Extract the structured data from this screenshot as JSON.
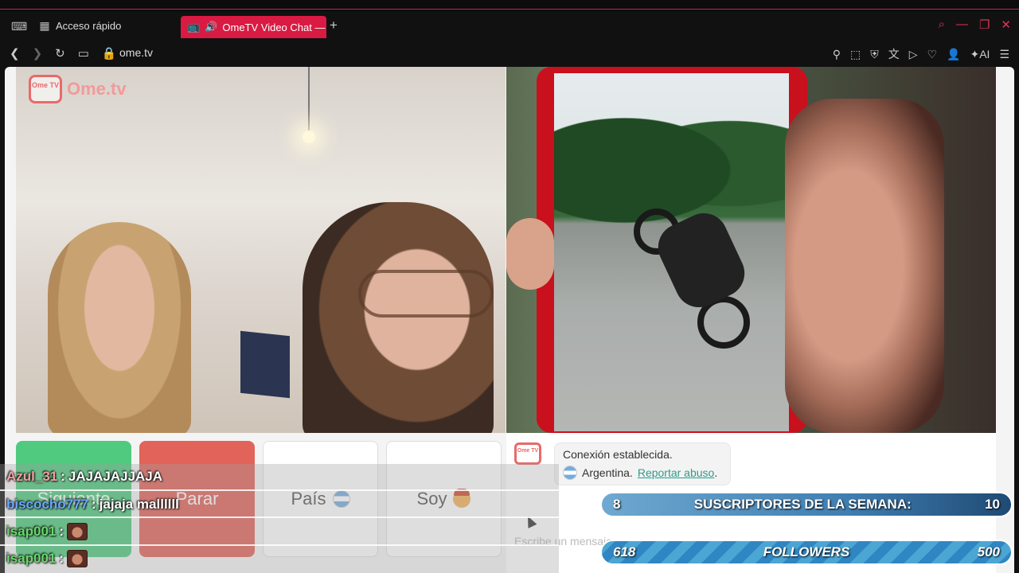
{
  "browser": {
    "quick_access_label": "Acceso rápido",
    "active_tab_title": "OmeTV Video Chat —",
    "new_tab_symbol": "+",
    "url": "ome.tv",
    "ai_label": "AI"
  },
  "site": {
    "logo_text": "Ome.tv",
    "logo_badge": "Ome TV"
  },
  "controls": {
    "next_label": "Siguiente",
    "stop_label": "Parar",
    "country_label": "País",
    "me_label": "Soy"
  },
  "chat": {
    "status": "Conexión establecida.",
    "country": "Argentina.",
    "report_link": "Reportar abuso",
    "report_suffix": ".",
    "input_placeholder": "Escribe un mensaje"
  },
  "stream_chat": [
    {
      "user": "Azul_31",
      "sep": " : ",
      "message": "JAJAJAJJAJA",
      "color": "#f0a0a0"
    },
    {
      "user": "biscocho777",
      "sep": " : ",
      "message": "jajaja mallllll",
      "color": "#6aa8ff"
    },
    {
      "user": "isap001",
      "sep": " : ",
      "message": "",
      "emote": "face-emote",
      "color": "#67d96b"
    },
    {
      "user": "isap001",
      "sep": " : ",
      "message": "",
      "emote": "face-emote",
      "color": "#67d96b"
    }
  ],
  "goals": {
    "subs_current": "8",
    "subs_label": "SUSCRIPTORES DE LA SEMANA:",
    "subs_target": "10",
    "followers_current": "618",
    "followers_label": "FOLLOWERS",
    "followers_target": "500"
  },
  "colors": {
    "tab_accent": "#d91a43",
    "next_button": "#4fca7e",
    "stop_button": "#e2635a"
  }
}
